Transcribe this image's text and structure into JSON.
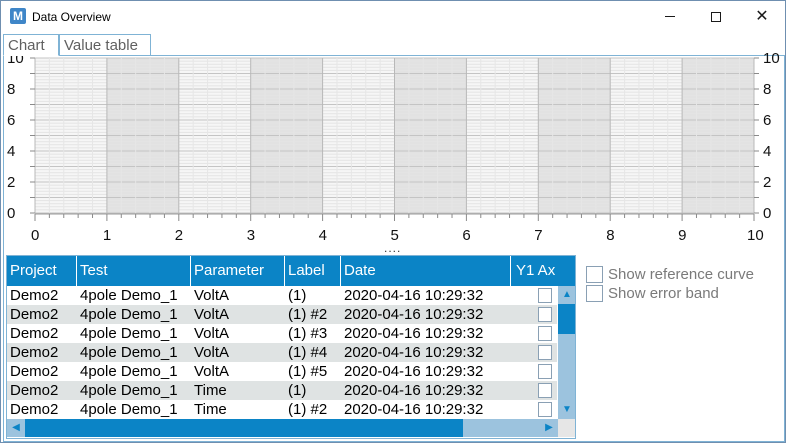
{
  "window": {
    "title": "Data Overview",
    "app_icon_letter": "M"
  },
  "tabs": [
    {
      "label": "Chart"
    },
    {
      "label": "Value table"
    }
  ],
  "chart": {
    "x_ticks": [
      "0",
      "1",
      "2",
      "3",
      "4",
      "5",
      "6",
      "7",
      "8",
      "9",
      "10"
    ],
    "y_ticks": [
      "0",
      "2",
      "4",
      "6",
      "8",
      "10"
    ],
    "x_range": [
      0,
      10
    ],
    "y_range": [
      0,
      10
    ],
    "splitter": "...."
  },
  "grid": {
    "columns": [
      "Project",
      "Test",
      "Parameter",
      "Label",
      "Date",
      "Y1 Ax"
    ],
    "rows": [
      {
        "project": "Demo2",
        "test": "4pole Demo_1",
        "parameter": "VoltA",
        "label": "(1)",
        "date": "2020-04-16 10:29:32"
      },
      {
        "project": "Demo2",
        "test": "4pole Demo_1",
        "parameter": "VoltA",
        "label": "(1) #2",
        "date": "2020-04-16 10:29:32"
      },
      {
        "project": "Demo2",
        "test": "4pole Demo_1",
        "parameter": "VoltA",
        "label": "(1) #3",
        "date": "2020-04-16 10:29:32"
      },
      {
        "project": "Demo2",
        "test": "4pole Demo_1",
        "parameter": "VoltA",
        "label": "(1) #4",
        "date": "2020-04-16 10:29:32"
      },
      {
        "project": "Demo2",
        "test": "4pole Demo_1",
        "parameter": "VoltA",
        "label": "(1) #5",
        "date": "2020-04-16 10:29:32"
      },
      {
        "project": "Demo2",
        "test": "4pole Demo_1",
        "parameter": "Time",
        "label": "(1)",
        "date": "2020-04-16 10:29:32"
      },
      {
        "project": "Demo2",
        "test": "4pole Demo_1",
        "parameter": "Time",
        "label": "(1) #2",
        "date": "2020-04-16 10:29:32"
      }
    ]
  },
  "options": {
    "show_reference_curve": "Show reference curve",
    "show_error_band": "Show error band"
  },
  "colors": {
    "accent": "#0b84c6",
    "scroll_track": "#9cc3de",
    "border": "#7fb3d5"
  }
}
